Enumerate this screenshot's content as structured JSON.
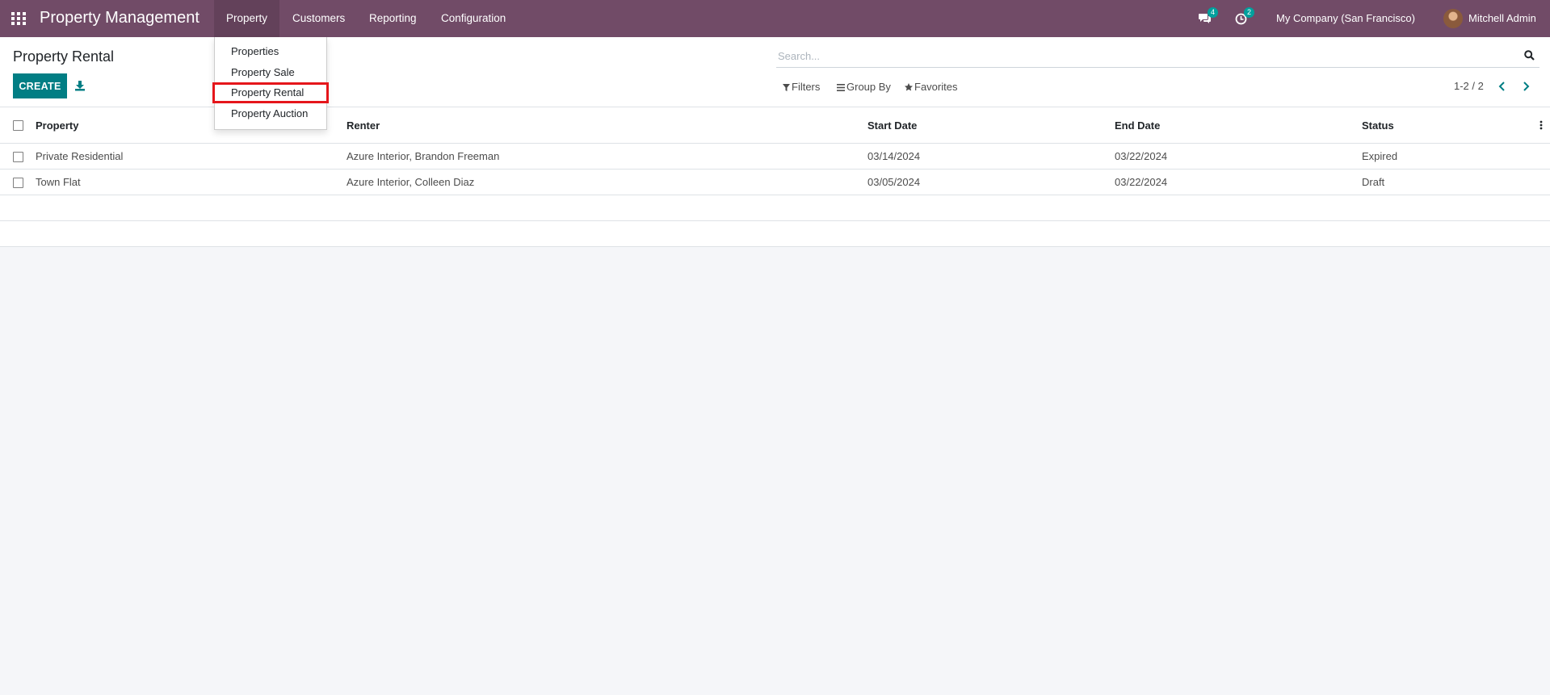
{
  "navbar": {
    "apps_icon": "grid-icon",
    "app_title": "Property Management",
    "menus": [
      {
        "label": "Property",
        "active": true
      },
      {
        "label": "Customers",
        "active": false
      },
      {
        "label": "Reporting",
        "active": false
      },
      {
        "label": "Configuration",
        "active": false
      }
    ],
    "messages_icon": "chat-icon",
    "messages_count": "4",
    "activities_icon": "clock-icon",
    "activities_count": "2",
    "company": "My Company (San Francisco)",
    "user_name": "Mitchell Admin",
    "colors": {
      "navbar_bg": "#714b67",
      "badge_bg": "#00a09d"
    }
  },
  "dropdown": {
    "items": [
      {
        "label": "Properties"
      },
      {
        "label": "Property Sale"
      },
      {
        "label": "Property Rental",
        "highlighted": true
      },
      {
        "label": "Property Auction"
      }
    ],
    "highlight_color": "#e5161b"
  },
  "control_panel": {
    "title": "Property Rental",
    "create_label": "CREATE",
    "download_icon": "download-icon",
    "search_placeholder": "Search...",
    "filters_label": "Filters",
    "group_by_label": "Group By",
    "favorites_label": "Favorites",
    "pager_value": "1-2 / 2",
    "primary_color": "#017e84"
  },
  "table": {
    "columns": [
      "Property",
      "Renter",
      "Start Date",
      "End Date",
      "Status"
    ],
    "rows": [
      {
        "property": "Private Residential",
        "renter": "Azure Interior, Brandon Freeman",
        "start_date": "03/14/2024",
        "end_date": "03/22/2024",
        "status": "Expired"
      },
      {
        "property": "Town Flat",
        "renter": "Azure Interior, Colleen Diaz",
        "start_date": "03/05/2024",
        "end_date": "03/22/2024",
        "status": "Draft"
      }
    ]
  }
}
